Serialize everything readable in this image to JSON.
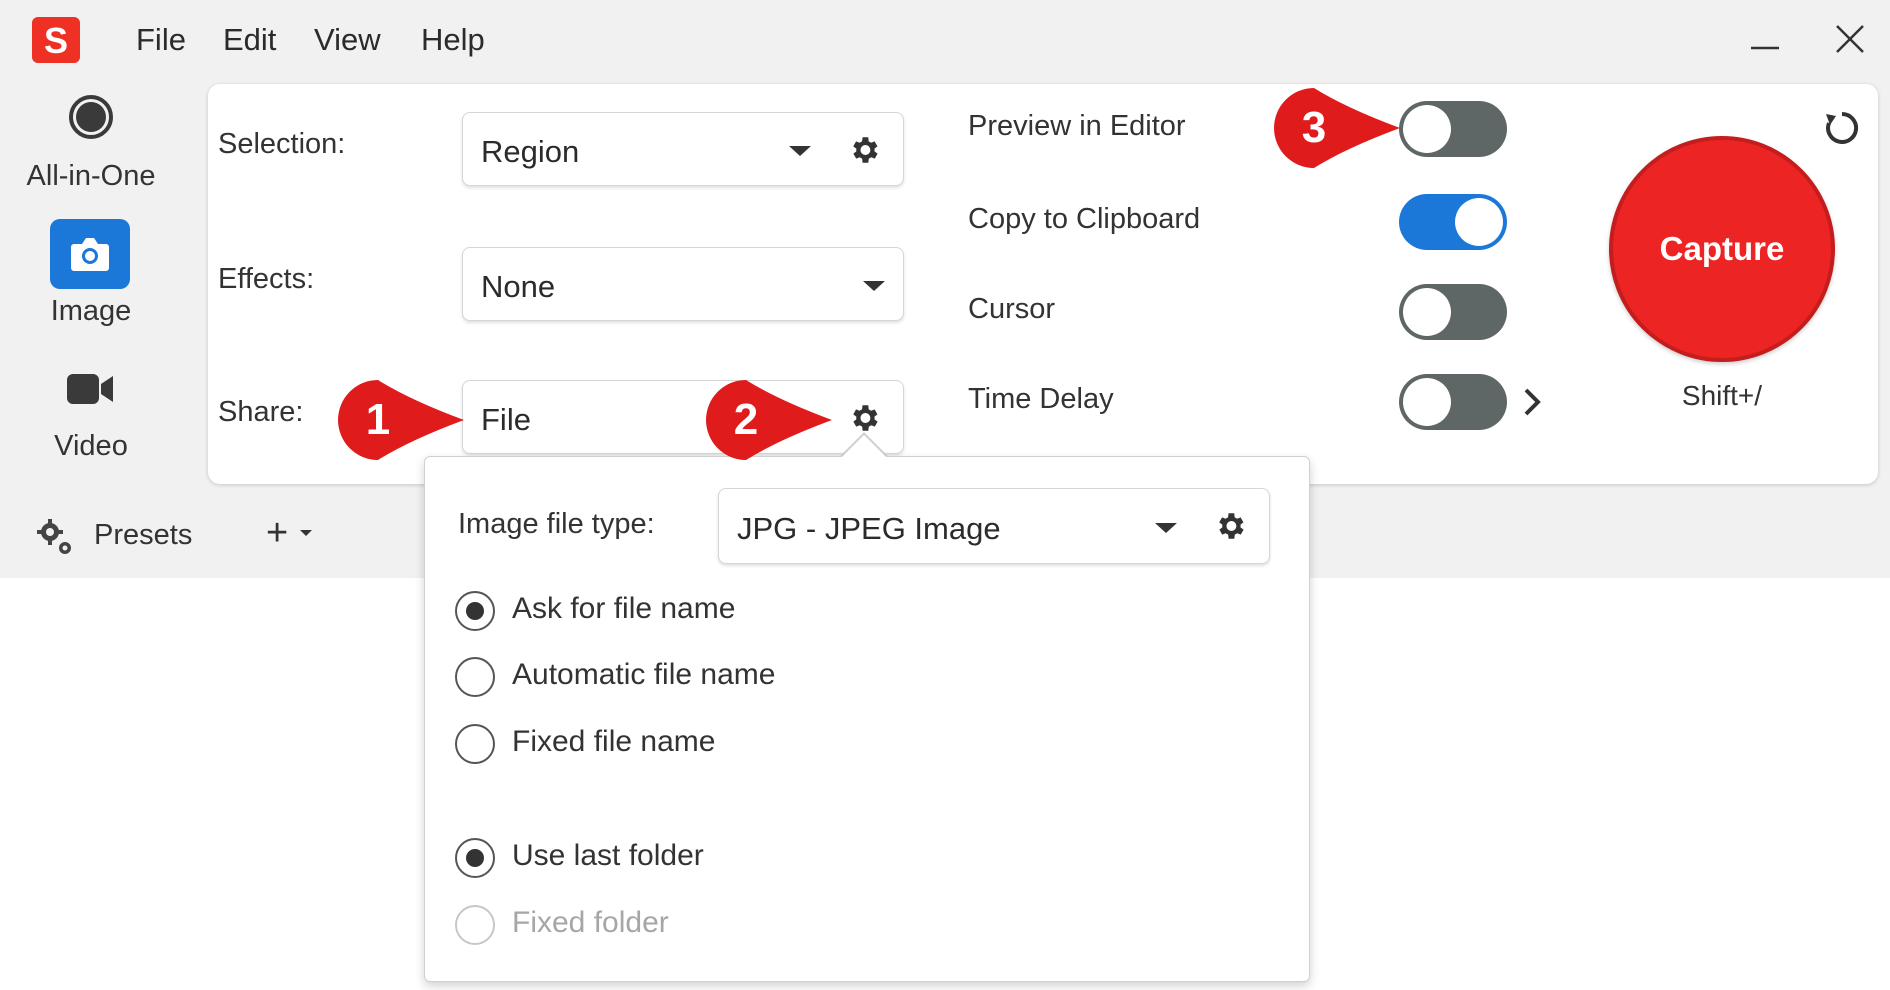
{
  "app": {
    "logo_letter": "S"
  },
  "menu": [
    "File",
    "Edit",
    "View",
    "Help"
  ],
  "window_controls": {
    "minimize": "minimize-icon",
    "close": "close-icon"
  },
  "rail": {
    "items": [
      {
        "label": "All-in-One",
        "icon": "record-icon",
        "selected": false
      },
      {
        "label": "Image",
        "icon": "camera-icon",
        "selected": true
      },
      {
        "label": "Video",
        "icon": "video-camera-icon",
        "selected": false
      }
    ],
    "presets_label": "Presets",
    "add_label": "+"
  },
  "settings": {
    "selection": {
      "label": "Selection:",
      "value": "Region"
    },
    "effects": {
      "label": "Effects:",
      "value": "None"
    },
    "share": {
      "label": "Share:",
      "value": "File"
    }
  },
  "options": [
    {
      "label": "Preview in Editor",
      "on": false
    },
    {
      "label": "Copy to Clipboard",
      "on": true
    },
    {
      "label": "Cursor",
      "on": false
    },
    {
      "label": "Time Delay",
      "on": false
    }
  ],
  "capture": {
    "label": "Capture",
    "shortcut": "Shift+/"
  },
  "callouts": [
    "1",
    "2",
    "3"
  ],
  "popup": {
    "file_type_label": "Image file type:",
    "file_type_value": "JPG - JPEG Image",
    "naming": [
      {
        "label": "Ask for file name",
        "checked": true
      },
      {
        "label": "Automatic file name",
        "checked": false
      },
      {
        "label": "Fixed file name",
        "checked": false
      }
    ],
    "folder": [
      {
        "label": "Use last folder",
        "checked": true,
        "disabled": false
      },
      {
        "label": "Fixed folder",
        "checked": false,
        "disabled": true
      }
    ]
  },
  "colors": {
    "accent_blue": "#1b78d8",
    "capture_red": "#ec2424",
    "callout_red": "#e01b1b"
  }
}
